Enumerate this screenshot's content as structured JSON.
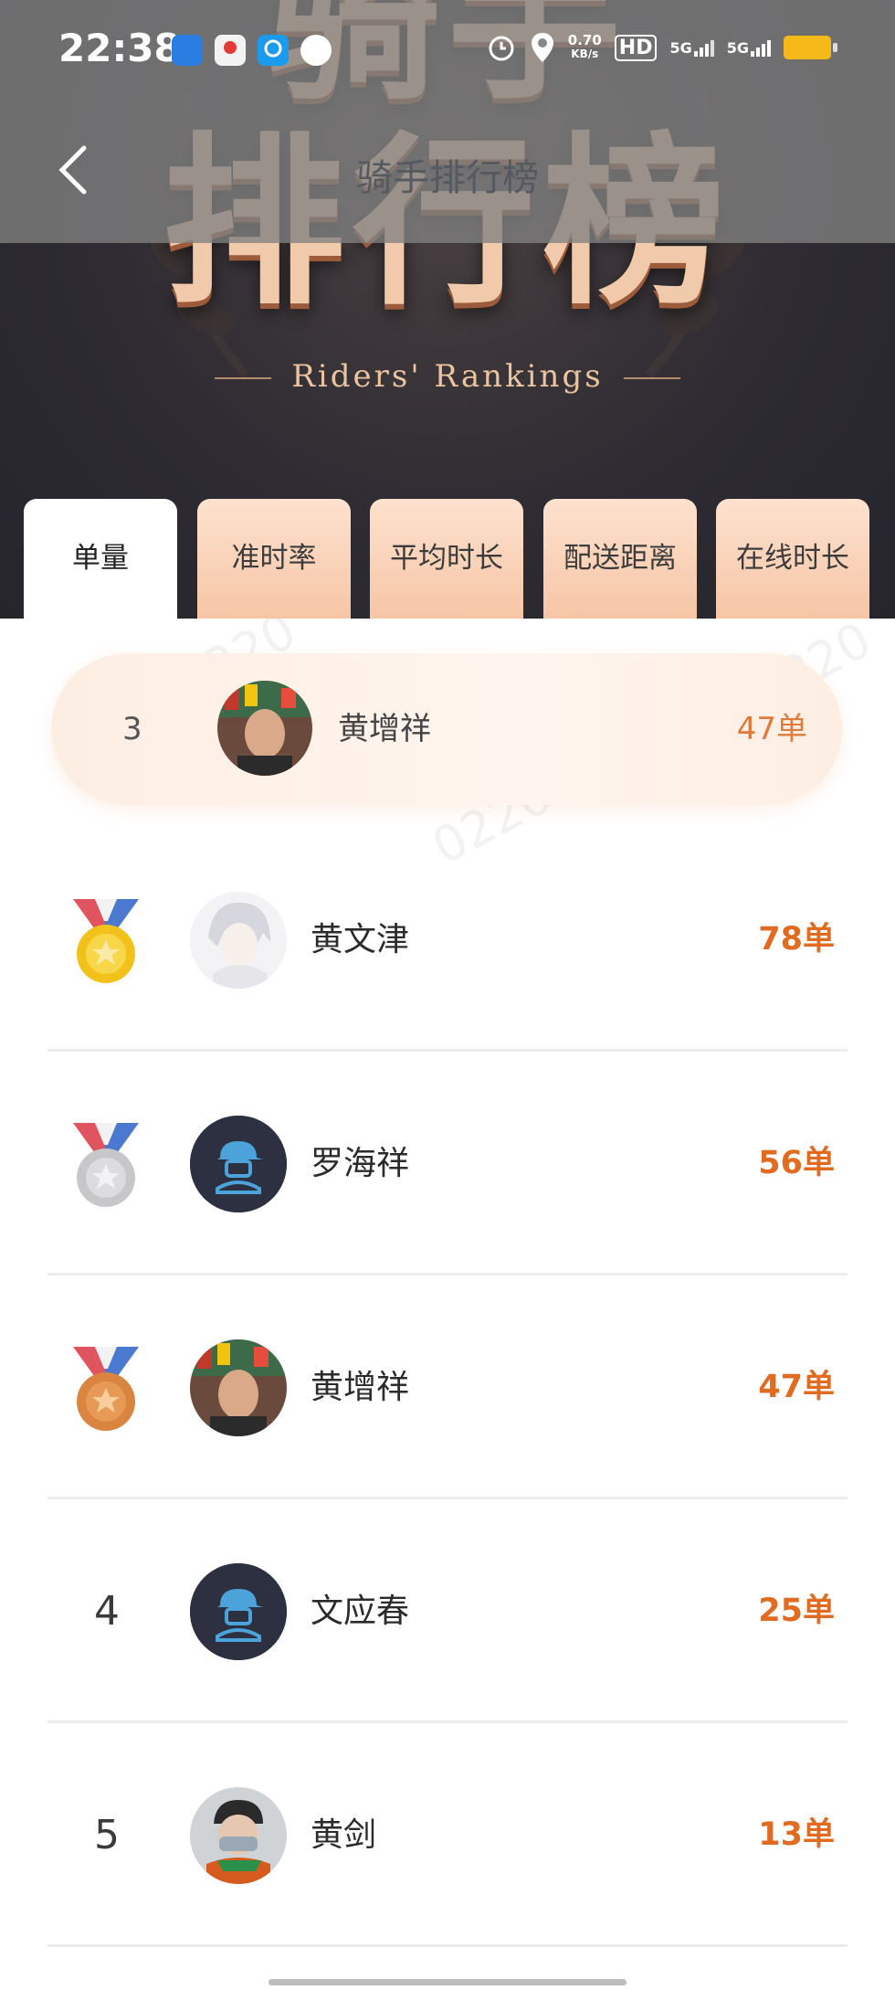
{
  "status_bar": {
    "time": "22:38",
    "apps": [
      "route-app-icon",
      "map-pin-app-icon",
      "eleme-app-icon",
      "white-dot-app-icon"
    ],
    "net_rate_value": "0.70",
    "net_rate_unit": "KB/s",
    "hd_label": "HD",
    "sim1_label": "5G",
    "sim2_label": "5G",
    "battery_color": "#f6b91a"
  },
  "nav": {
    "back_icon": "chevron-left-icon",
    "title": "骑手排行榜"
  },
  "hero": {
    "title_line1": "骑手",
    "title_line2": "排行榜",
    "subtitle": "Riders' Rankings",
    "title_color": "#f1c9ab"
  },
  "tabs": [
    {
      "label": "单量",
      "active": true
    },
    {
      "label": "准时率",
      "active": false
    },
    {
      "label": "平均时长",
      "active": false
    },
    {
      "label": "配送距离",
      "active": false
    },
    {
      "label": "在线时长",
      "active": false
    }
  ],
  "my_rank": {
    "rank": "3",
    "name": "黄增祥",
    "count": "47单",
    "avatar": "man-portrait-avatar"
  },
  "rankings": [
    {
      "rank_display": "",
      "medal": "gold-medal-icon",
      "name": "黄文津",
      "count": "78单",
      "avatar": "anime-character-avatar"
    },
    {
      "rank_display": "",
      "medal": "silver-medal-icon",
      "name": "罗海祥",
      "count": "56单",
      "avatar": "default-rider-avatar"
    },
    {
      "rank_display": "",
      "medal": "bronze-medal-icon",
      "name": "黄增祥",
      "count": "47单",
      "avatar": "man-portrait-avatar"
    },
    {
      "rank_display": "4",
      "medal": "",
      "name": "文应春",
      "count": "25单",
      "avatar": "default-rider-avatar"
    },
    {
      "rank_display": "5",
      "medal": "",
      "name": "黄剑",
      "count": "13单",
      "avatar": "masked-person-avatar"
    }
  ],
  "colors": {
    "accent": "#e06b21",
    "tab_bg": "#f6c5a5",
    "hero_bg": "#2e2b32"
  }
}
